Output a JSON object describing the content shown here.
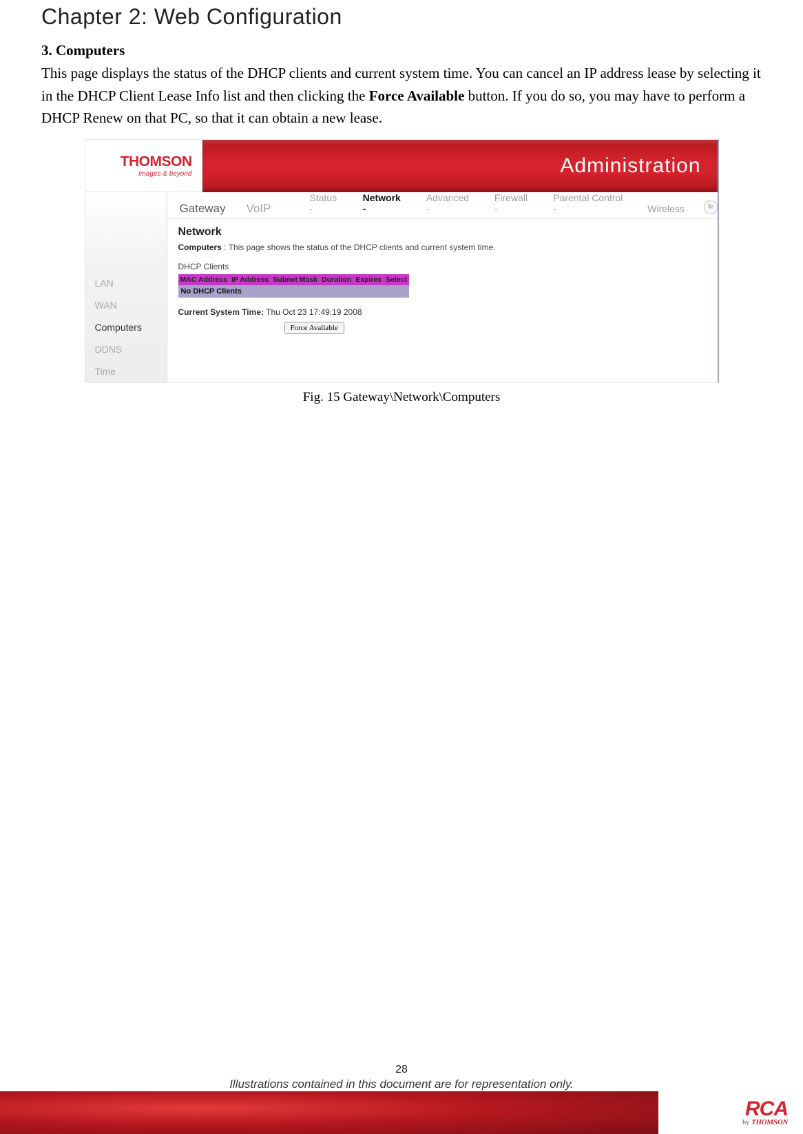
{
  "chapter_title": "Chapter 2: Web Configuration",
  "section": {
    "number_title": "3. Computers",
    "paragraph_pre": "This page displays the status of the DHCP clients and current system time. You can cancel an IP address lease by selecting it in the DHCP Client Lease Info list and then clicking the ",
    "paragraph_bold": "Force Available",
    "paragraph_post": " button. If you do so, you may have to perform a DHCP Renew on that PC, so that it can obtain a new lease."
  },
  "screenshot": {
    "logo_brand": "THOMSON",
    "logo_tag": "images & beyond",
    "header_title": "Administration",
    "tabs_big": [
      "Gateway",
      "VoIP"
    ],
    "tabs_big_active_index": 0,
    "tabs_small": [
      "Status -",
      "Network -",
      "Advanced -",
      "Firewall -",
      "Parental Control -",
      "Wireless"
    ],
    "tabs_small_active_index": 1,
    "side_items": [
      "LAN",
      "WAN",
      "Computers",
      "DDNS",
      "Time"
    ],
    "side_active_index": 2,
    "page_title": "Network",
    "desc_label": "Computers",
    "desc_sep": " : ",
    "desc_text": "This page shows the status of the DHCP clients and current system time.",
    "dhcp_label": "DHCP Clients",
    "dhcp_headers": [
      "MAC Address",
      "IP Address",
      "Subnet Mask",
      "Duration",
      "Expires",
      "Select"
    ],
    "dhcp_empty_row": "No DHCP Clients",
    "systime_label": "Current System Time:",
    "systime_value": "Thu Oct 23 17:49:19 2008",
    "button_label": "Force Available"
  },
  "figure_caption": "Fig. 15 Gateway\\Network\\Computers",
  "footer": {
    "page_number": "28",
    "note": "Illustrations contained in this document are for representation only.",
    "rca": "RCA",
    "by": "by",
    "thomson": "THOMSON"
  }
}
